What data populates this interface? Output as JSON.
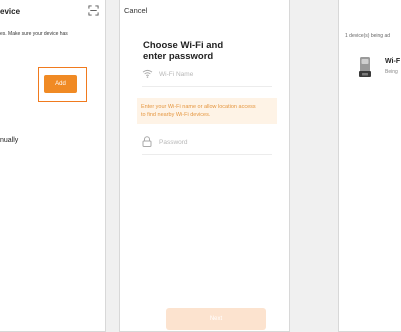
{
  "screen1": {
    "title": "evice",
    "scan_icon": "scan-qr-icon",
    "description": "es. Make sure your device has",
    "add_label": "Add",
    "manual_label": "nually",
    "accent_color": "#f08a24"
  },
  "screen2": {
    "cancel_label": "Cancel",
    "title_line1": "Choose Wi-Fi and",
    "title_line2": "enter password",
    "wifi_icon": "wifi-icon",
    "wifi_placeholder": "Wi-Fi Name",
    "notice_line1": "Enter your Wi-Fi name or allow location access",
    "notice_line2": "to find nearby Wi-Fi devices.",
    "lock_icon": "lock-icon",
    "password_placeholder": "Password",
    "next_label": "Next",
    "notice_bg": "#fef3e6",
    "notice_text_color": "#e5963f"
  },
  "screen3": {
    "status_text": "1 device(s) being ad",
    "device_icon": "feeder-device-icon",
    "device_name": "Wi-F",
    "device_status": "Being"
  }
}
